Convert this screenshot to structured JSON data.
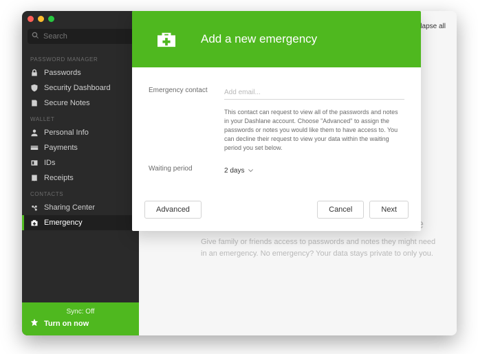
{
  "search": {
    "placeholder": "Search"
  },
  "sidebar": {
    "sections": [
      {
        "label": "PASSWORD MANAGER",
        "items": [
          {
            "id": "passwords",
            "label": "Passwords",
            "icon": "lock-icon"
          },
          {
            "id": "security-dashboard",
            "label": "Security Dashboard",
            "icon": "shield-icon"
          },
          {
            "id": "secure-notes",
            "label": "Secure Notes",
            "icon": "note-icon"
          }
        ]
      },
      {
        "label": "WALLET",
        "items": [
          {
            "id": "personal-info",
            "label": "Personal Info",
            "icon": "person-icon"
          },
          {
            "id": "payments",
            "label": "Payments",
            "icon": "card-icon"
          },
          {
            "id": "ids",
            "label": "IDs",
            "icon": "id-icon"
          },
          {
            "id": "receipts",
            "label": "Receipts",
            "icon": "receipt-icon"
          }
        ]
      },
      {
        "label": "CONTACTS",
        "items": [
          {
            "id": "sharing-center",
            "label": "Sharing Center",
            "icon": "share-icon"
          },
          {
            "id": "emergency",
            "label": "Emergency",
            "icon": "emergency-icon",
            "active": true
          }
        ]
      }
    ],
    "footer": {
      "sync_label": "Sync: Off",
      "turn_on_label": "Turn on now"
    }
  },
  "main": {
    "collapse_label": "Collapse all",
    "bg_title_fragment": "lane",
    "bg_desc": "Give family or friends access to passwords and notes they might need in an emergency. No emergency? Your data stays private to only you."
  },
  "modal": {
    "title": "Add a new emergency",
    "contact_label": "Emergency contact",
    "contact_placeholder": "Add email...",
    "help_text": "This contact can request to view all of the passwords and notes in your Dashlane account. Choose \"Advanced\" to assign the passwords or notes you would like them to have access to. You can decline their request to view your data within the waiting period you set below.",
    "waiting_label": "Waiting period",
    "waiting_value": "2 days",
    "buttons": {
      "advanced": "Advanced",
      "cancel": "Cancel",
      "next": "Next"
    }
  }
}
